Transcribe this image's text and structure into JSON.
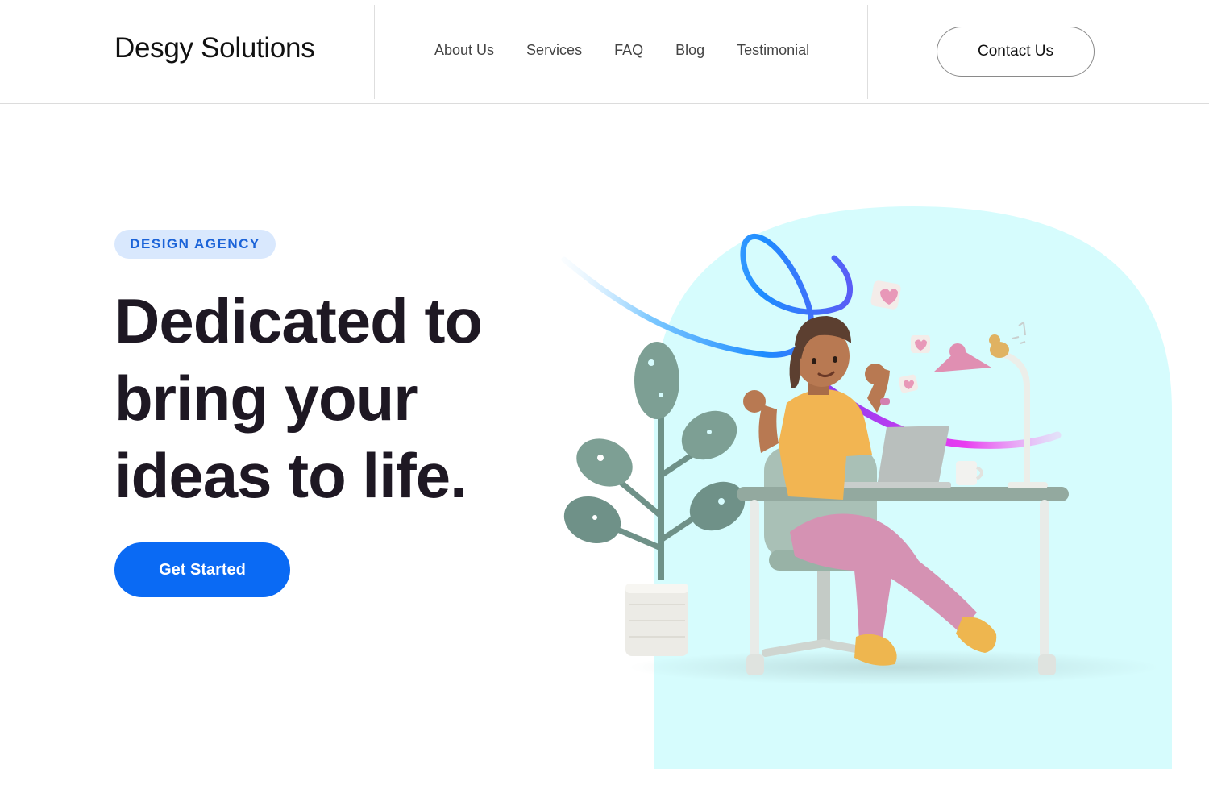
{
  "header": {
    "brand": "Desgy Solutions",
    "nav": [
      "About Us",
      "Services",
      "FAQ",
      "Blog",
      "Testimonial"
    ],
    "contact_label": "Contact Us"
  },
  "hero": {
    "tag": "DESIGN AGENCY",
    "headline_lines": [
      "Dedicated to",
      "bring your",
      "ideas to life."
    ],
    "cta_label": "Get Started"
  },
  "colors": {
    "accent": "#0a6af4",
    "tag_bg": "#d9e8fd",
    "tag_text": "#1b63d8",
    "arch_bg": "#d6fcfd",
    "headline": "#1e1823"
  },
  "illustration": {
    "subject": "woman-at-desk-with-laptop-illustration"
  }
}
